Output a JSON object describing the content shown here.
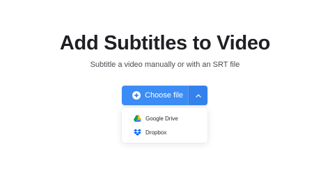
{
  "header": {
    "title": "Add Subtitles to Video",
    "subtitle": "Subtitle a video manually or with an SRT file"
  },
  "upload": {
    "button_label": "Choose file",
    "button_icon": "plus-circle-icon",
    "toggle_icon": "chevron-up-icon",
    "accent_color": "#3b8cf5"
  },
  "dropdown": {
    "items": [
      {
        "label": "Google Drive",
        "icon": "google-drive-icon"
      },
      {
        "label": "Dropbox",
        "icon": "dropbox-icon"
      }
    ]
  }
}
